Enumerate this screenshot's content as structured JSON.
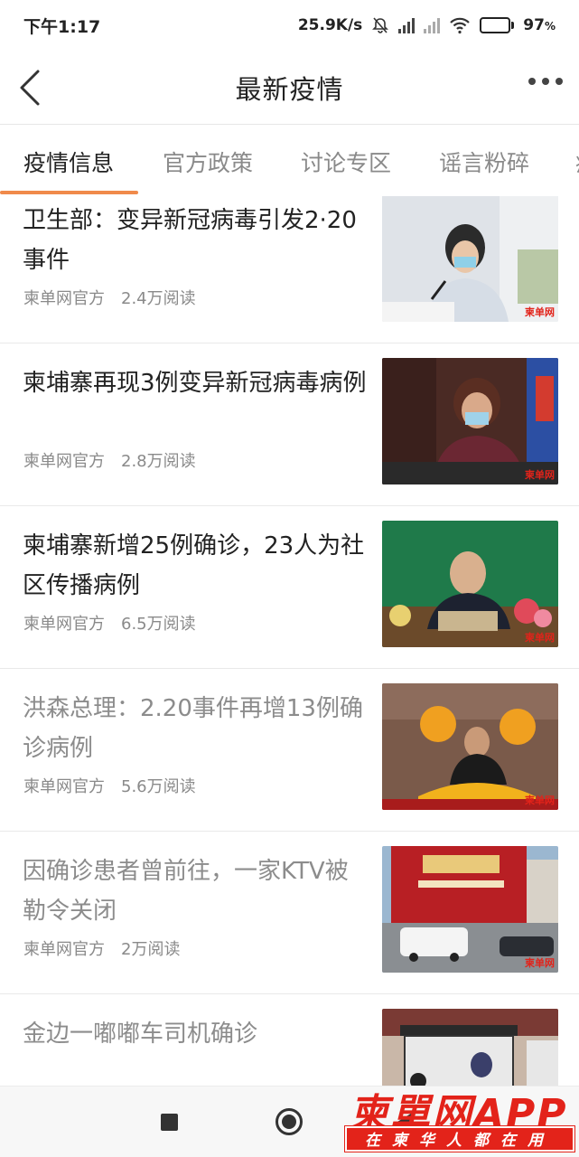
{
  "status": {
    "time": "下午1:17",
    "net_speed": "25.9K/s",
    "battery_pct": "97",
    "battery_unit": "%"
  },
  "header": {
    "title": "最新疫情"
  },
  "tabs": [
    {
      "label": "疫情信息",
      "active": true
    },
    {
      "label": "官方政策"
    },
    {
      "label": "讨论专区"
    },
    {
      "label": "谣言粉碎"
    },
    {
      "label": "疫"
    }
  ],
  "articles": [
    {
      "title": "卫生部：变异新冠病毒引发2·20事件",
      "source": "柬单网官方",
      "reads": "2.4万阅读",
      "read": false,
      "thumb_mark": "柬单网"
    },
    {
      "title": "柬埔寨再现3例变异新冠病毒病例",
      "source": "柬单网官方",
      "reads": "2.8万阅读",
      "read": false,
      "thumb_mark": "柬单网"
    },
    {
      "title": "柬埔寨新增25例确诊，23人为社区传播病例",
      "source": "柬单网官方",
      "reads": "6.5万阅读",
      "read": false,
      "thumb_mark": "柬单网"
    },
    {
      "title": "洪森总理：2.20事件再增13例确诊病例",
      "source": "柬单网官方",
      "reads": "5.6万阅读",
      "read": true,
      "thumb_mark": "柬单网"
    },
    {
      "title": "因确诊患者曾前往，一家KTV被勒令关闭",
      "source": "柬单网官方",
      "reads": "2万阅读",
      "read": true,
      "thumb_mark": "柬单网"
    },
    {
      "title": "金边一嘟嘟车司机确诊",
      "source": "",
      "reads": "",
      "read": true,
      "thumb_mark": ""
    }
  ],
  "watermark": {
    "brand": "柬單网APP",
    "slogan": "在柬华人都在用"
  },
  "colors": {
    "accent": "#f08a4b",
    "brand_red": "#e3231a"
  }
}
